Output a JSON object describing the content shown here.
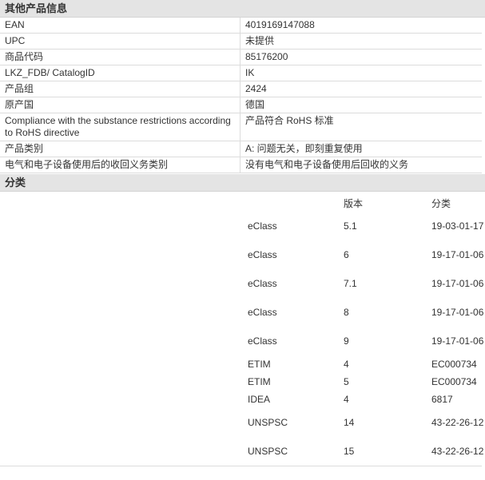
{
  "sections": {
    "other_info_title": "其他产品信息",
    "classification_title": "分类"
  },
  "info_rows": [
    {
      "label": "EAN",
      "value": "4019169147088"
    },
    {
      "label": "UPC",
      "value": "未提供"
    },
    {
      "label": "商品代码",
      "value": "85176200"
    },
    {
      "label": "LKZ_FDB/ CatalogID",
      "value": "IK"
    },
    {
      "label": "产品组",
      "value": "2424"
    },
    {
      "label": "原产国",
      "value": "德国"
    },
    {
      "label": "Compliance with the substance restrictions according to RoHS directive",
      "value": "产品符合 RoHS 标准"
    },
    {
      "label": "产品类别",
      "value": "A: 问题无关，即刻重复使用"
    },
    {
      "label": "电气和电子设备使用后的收回义务类别",
      "value": "没有电气和电子设备使用后回收的义务"
    }
  ],
  "classification": {
    "headers": {
      "system": "",
      "version": "版本",
      "class": "分类"
    },
    "rows": [
      {
        "system": "eClass",
        "version": "5.1",
        "class": "19-03-01-17"
      },
      {
        "system": "eClass",
        "version": "6",
        "class": "19-17-01-06"
      },
      {
        "system": "eClass",
        "version": "7.1",
        "class": "19-17-01-06"
      },
      {
        "system": "eClass",
        "version": "8",
        "class": "19-17-01-06"
      },
      {
        "system": "eClass",
        "version": "9",
        "class": "19-17-01-06"
      },
      {
        "system": "ETIM",
        "version": "4",
        "class": "EC000734"
      },
      {
        "system": "ETIM",
        "version": "5",
        "class": "EC000734"
      },
      {
        "system": "IDEA",
        "version": "4",
        "class": "6817"
      },
      {
        "system": "UNSPSC",
        "version": "14",
        "class": "43-22-26-12"
      },
      {
        "system": "UNSPSC",
        "version": "15",
        "class": "43-22-26-12"
      }
    ]
  }
}
